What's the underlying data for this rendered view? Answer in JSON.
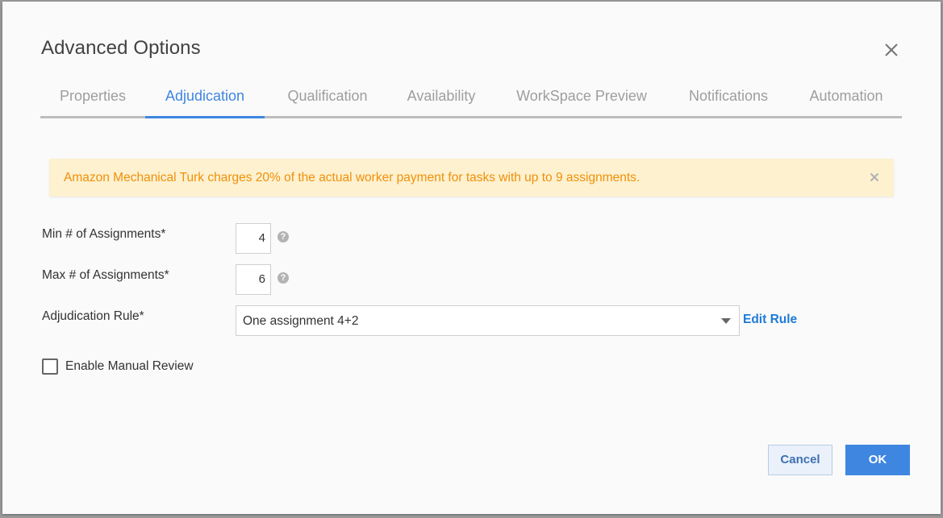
{
  "dialog": {
    "title": "Advanced Options"
  },
  "tabs": [
    {
      "label": "Properties",
      "active": false
    },
    {
      "label": "Adjudication",
      "active": true
    },
    {
      "label": "Qualification",
      "active": false
    },
    {
      "label": "Availability",
      "active": false
    },
    {
      "label": "WorkSpace Preview",
      "active": false
    },
    {
      "label": "Notifications",
      "active": false
    },
    {
      "label": "Automation",
      "active": false
    }
  ],
  "banner": {
    "text": "Amazon Mechanical Turk charges 20% of the actual worker payment for tasks with up to 9 assignments."
  },
  "form": {
    "min_label": "Min # of Assignments*",
    "min_value": "4",
    "max_label": "Max # of Assignments*",
    "max_value": "6",
    "help_glyph": "?",
    "rule_label": "Adjudication Rule*",
    "rule_value": "One assignment 4+2",
    "edit_rule_label": "Edit Rule",
    "manual_review_label": "Enable Manual Review",
    "manual_review_checked": false
  },
  "footer": {
    "cancel_label": "Cancel",
    "ok_label": "OK"
  },
  "colors": {
    "accent": "#3f86e0",
    "banner_bg": "#fdf1cf",
    "banner_text": "#f0900a",
    "link": "#1e7bd8"
  },
  "icons": {
    "close": "close-icon",
    "banner_close": "close-icon",
    "help": "help-circle-icon",
    "dropdown": "caret-down-icon"
  }
}
